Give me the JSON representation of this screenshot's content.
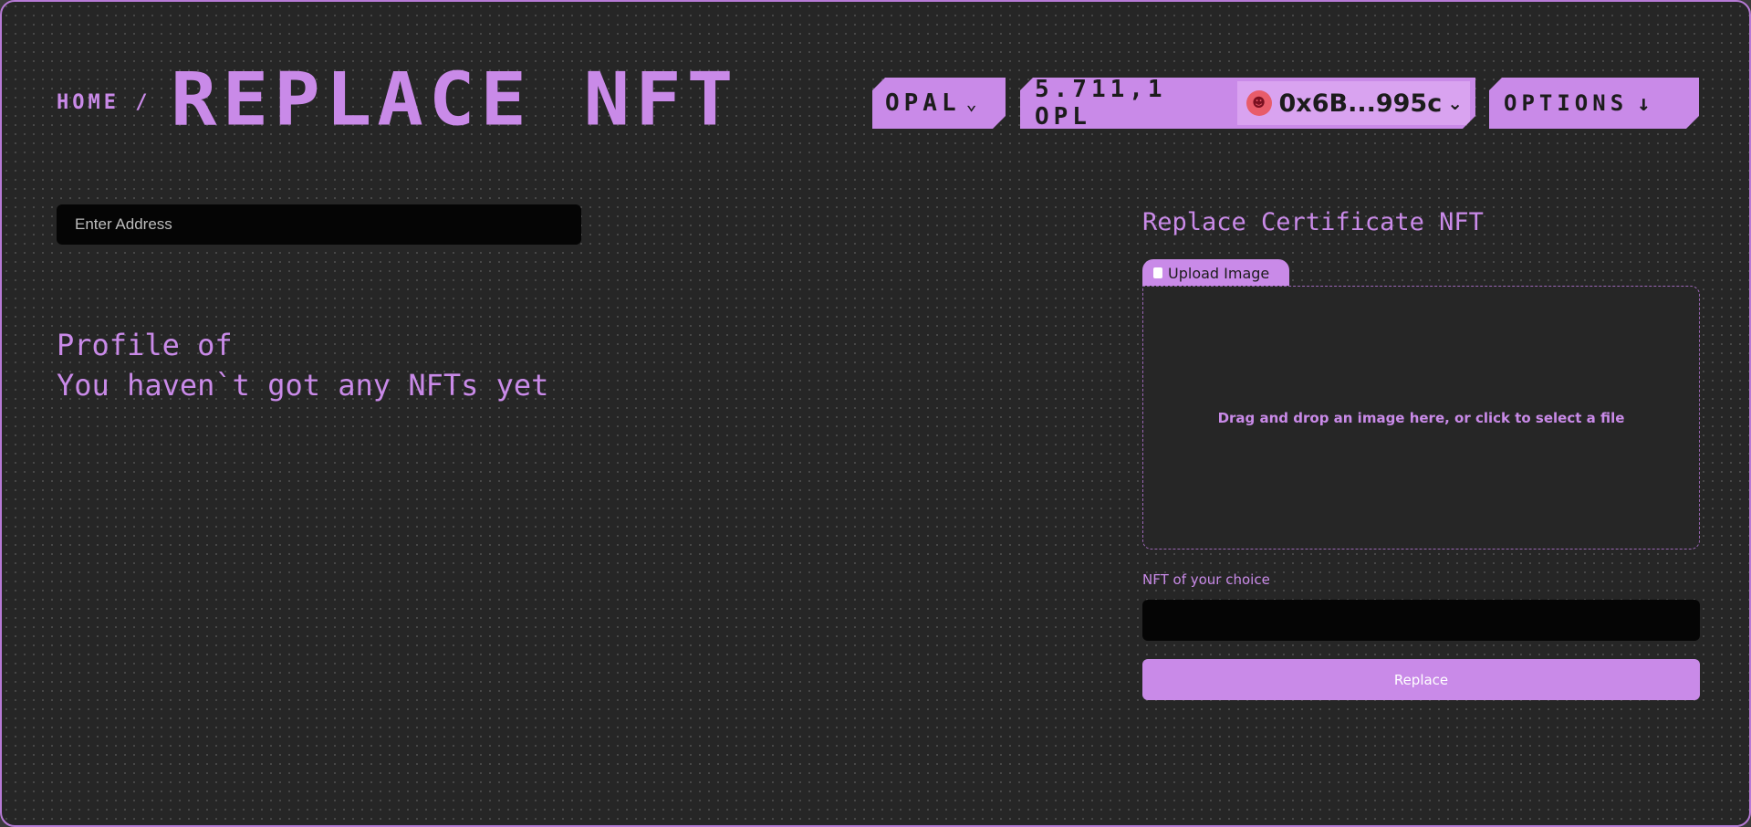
{
  "header": {
    "breadcrumb": "HOME /",
    "title": "REPLACE NFT",
    "network": "OPAL",
    "balance": "5.711,1 OPL",
    "address": "0x6B...995c",
    "options": "OPTIONS"
  },
  "icons": {
    "network_chevron": "chevron-down-icon",
    "address_chevron": "chevron-down-icon",
    "options_arrow": "arrow-down-icon",
    "avatar": "avatar-icon",
    "upload": "file-icon"
  },
  "left": {
    "address_placeholder": "Enter Address",
    "profile_label": "Profile of",
    "empty_message": "You haven`t got any NFTs yet"
  },
  "right": {
    "title": "Replace Certificate NFT",
    "upload_tab": "Upload Image",
    "drop_text": "Drag and drop an image here, or click to select a file",
    "nft_label": "NFT of your choice",
    "nft_value": "",
    "replace_button": "Replace"
  },
  "colors": {
    "accent": "#c98ae8",
    "background": "#262626",
    "input_bg": "#050505"
  }
}
